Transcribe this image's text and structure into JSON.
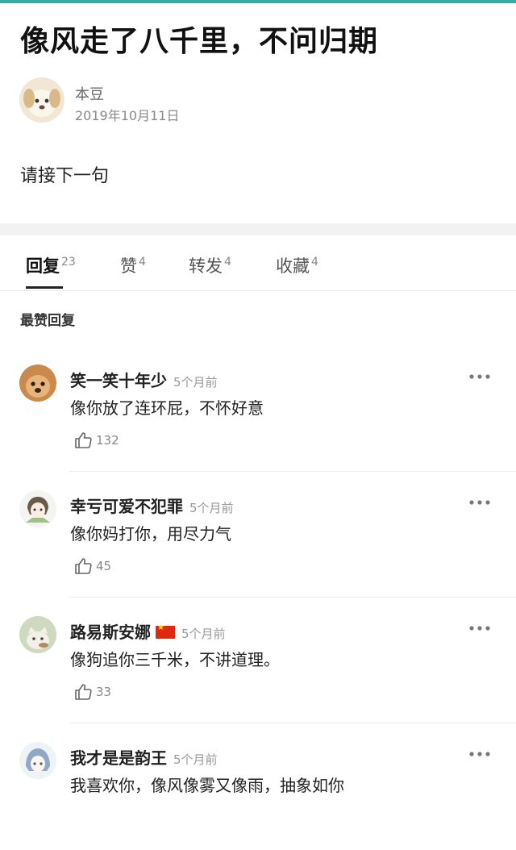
{
  "post": {
    "title": "像风走了八千里，不问归期",
    "author": "本豆",
    "date": "2019年10月11日",
    "body": "请接下一句"
  },
  "tabs": [
    {
      "label": "回复",
      "count": "23",
      "active": true
    },
    {
      "label": "赞",
      "count": "4",
      "active": false
    },
    {
      "label": "转发",
      "count": "4",
      "active": false
    },
    {
      "label": "收藏",
      "count": "4",
      "active": false
    }
  ],
  "section_label": "最赞回复",
  "comments": [
    {
      "name": "笑一笑十年少",
      "time": "5个月前",
      "text": "像你放了连环屁，不怀好意",
      "likes": "132",
      "avatar_icon": "dog-avatar-icon"
    },
    {
      "name": "幸亏可爱不犯罪",
      "time": "5个月前",
      "text": "像你妈打你，用尽力气",
      "likes": "45",
      "avatar_icon": "cartoon-girl-avatar-icon"
    },
    {
      "name": "路易斯安娜",
      "time": "5个月前",
      "text": "像狗追你三千米，不讲道理。",
      "likes": "33",
      "avatar_icon": "cat-avatar-icon",
      "flag_icon": "china-flag-icon"
    },
    {
      "name": "我才是是韵王",
      "time": "5个月前",
      "text": "我喜欢你，像风像雾又像雨，抽象如你",
      "likes": "",
      "avatar_icon": "anime-avatar-icon"
    }
  ],
  "colors": {
    "accent": "#3aa8a6",
    "flag": "#de2910"
  }
}
